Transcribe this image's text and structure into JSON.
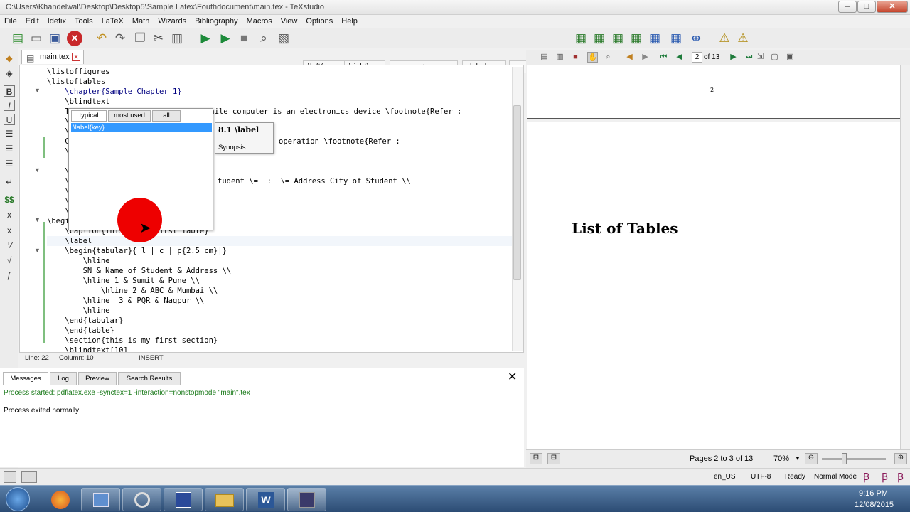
{
  "window": {
    "title": "C:\\Users\\Khandelwal\\Desktop\\Desktop5\\Sample Latex\\Fouthdocument\\main.tex - TeXstudio",
    "min": "–",
    "max": "□",
    "close": "✕"
  },
  "menu": [
    "File",
    "Edit",
    "Idefix",
    "Tools",
    "LaTeX",
    "Math",
    "Wizards",
    "Bibliography",
    "Macros",
    "View",
    "Options",
    "Help"
  ],
  "toolbar": {
    "left_label": "\\left(",
    "right_label": "\\right)",
    "part_label": "part",
    "label_label": "label",
    "tiny_label": "tiny"
  },
  "editor": {
    "tab_label": "main.tex",
    "lines": [
      "\\listoffigures",
      "\\listoftables",
      "    \\chapter{Sample Chapter 1}",
      "    \\blindtext",
      "    T",
      "    \\",
      "    \\",
      "    C",
      "    \\",
      "",
      "    \\",
      "    \\",
      "    \\",
      "    \\",
      "    \\",
      "\\begi",
      "    \\caption{This is my first Table}",
      "    \\label",
      "    \\begin{tabular}{|l | c | p{2.5 cm}|}",
      "        \\hline",
      "        SN & Name of Student & Address \\\\",
      "        \\hline 1 & Sumit & Pune \\\\",
      "            \\hline 2 & ABC & Mumbai \\\\",
      "        \\hline  3 & PQR & Nagpur \\\\",
      "        \\hline",
      "    \\end{tabular}",
      "    \\end{table}",
      "    \\section{this is my first section}",
      "    \\blindtext[10]"
    ],
    "frag_footnote1": "e, while computer is an electronics device \\footnote{Refer :",
    "frag_footnote2": "operation \\footnote{Refer :",
    "frag_address": "tudent \\=  :  \\= Address City of Student \\\\"
  },
  "status": {
    "line": "Line: 22",
    "column": "Column: 10",
    "mode": "INSERT"
  },
  "completion": {
    "tabs": [
      "typical",
      "most used",
      "all"
    ],
    "selected": "\\label{key}",
    "tip_title": "8.1 \\label",
    "tip_synopsis": "Synopsis:"
  },
  "messages": {
    "tabs": [
      "Messages",
      "Log",
      "Preview",
      "Search Results"
    ],
    "line1": "Process started: pdflatex.exe -synctex=1 -interaction=nonstopmode \"main\".tex",
    "line2": "Process exited normally"
  },
  "pdf": {
    "page_field": "2",
    "page_of": "of 13",
    "page1_num": "2",
    "heading": "List of Tables",
    "pages_status": "Pages 2 to 3 of 13",
    "zoom": "70%"
  },
  "bottom": {
    "lang": "en_US",
    "encoding": "UTF-8",
    "ready": "Ready",
    "normal_mode": "Normal Mode"
  },
  "taskbar": {
    "time": "9:16 PM",
    "date": "12/08/2015"
  },
  "colors": {
    "accent": "#3399ff",
    "pdf_border": "#555555",
    "cursor_dot": "#e00000"
  }
}
